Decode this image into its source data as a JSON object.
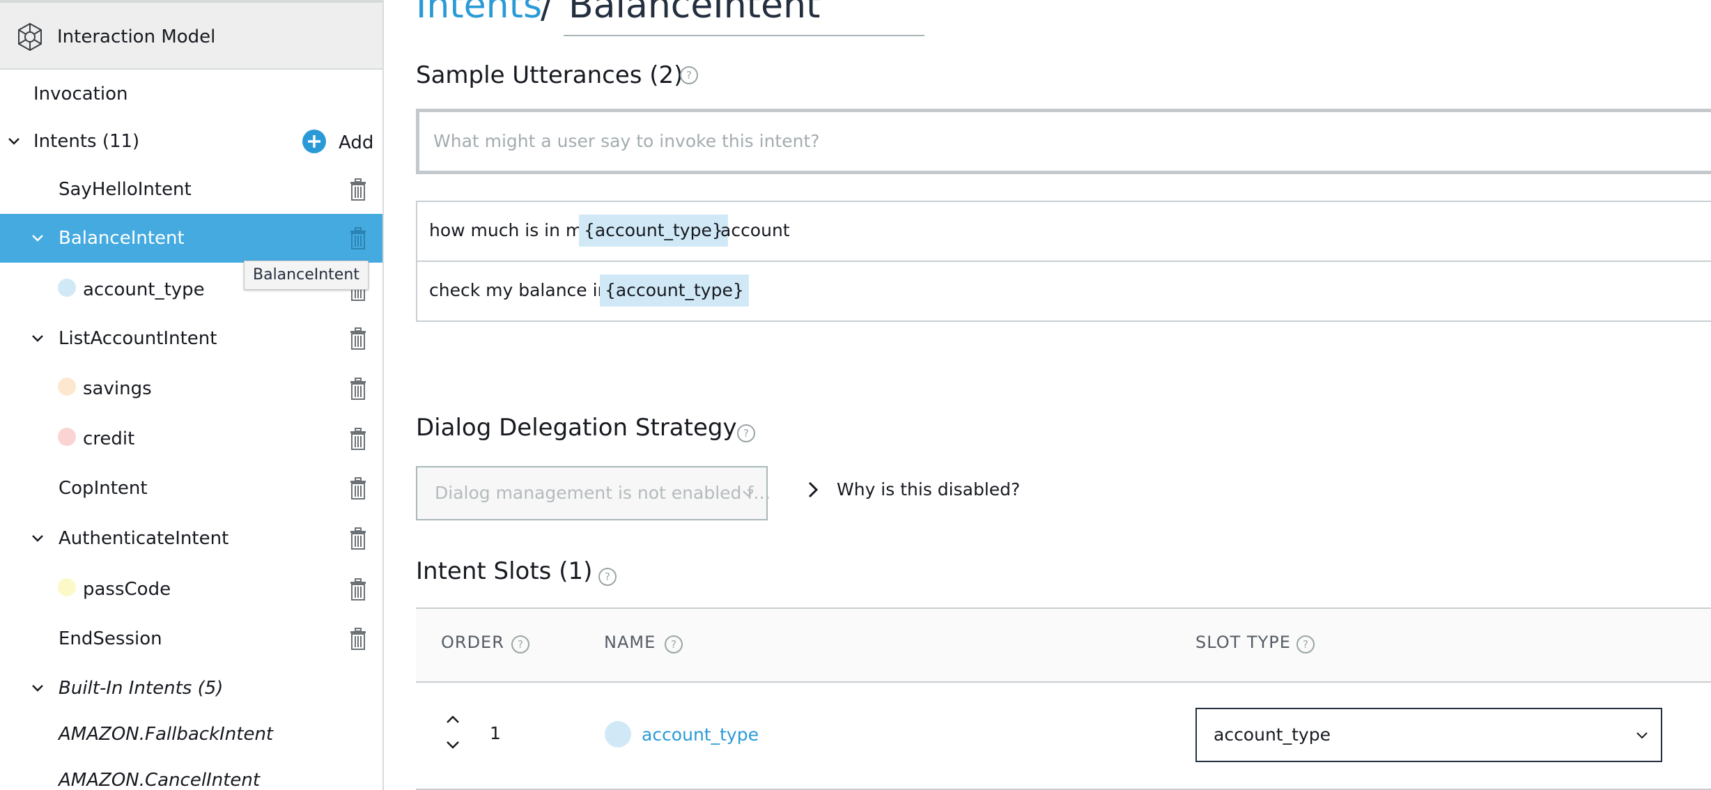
{
  "sidebar": {
    "header": {
      "title": "Interaction Model",
      "icon": "gear-icon"
    },
    "invocation": "Invocation",
    "intents_label": "Intents (11)",
    "add_label": "Add",
    "items": [
      {
        "label": "SayHelloIntent"
      },
      {
        "label": "BalanceIntent",
        "selected": true
      },
      {
        "label": "account_type",
        "dot_color": "#d1e9f7"
      },
      {
        "label": "ListAccountIntent"
      },
      {
        "label": "savings",
        "dot_color": "#fde8cf"
      },
      {
        "label": "credit",
        "dot_color": "#fbd3d3"
      },
      {
        "label": "CopIntent"
      },
      {
        "label": "AuthenticateIntent"
      },
      {
        "label": "passCode",
        "dot_color": "#fcf9c9"
      },
      {
        "label": "EndSession"
      }
    ],
    "builtin_label": "Built-In Intents (5)",
    "builtin_items": [
      {
        "label": "AMAZON.FallbackIntent"
      },
      {
        "label": "AMAZON.CancelIntent"
      }
    ],
    "tooltip": "BalanceIntent"
  },
  "breadcrumb": {
    "parent": "Intents",
    "separator": "/",
    "current": "BalanceIntent"
  },
  "utterances": {
    "title": "Sample Utterances (2)",
    "help": "?",
    "placeholder": "What might a user say to invoke this intent?",
    "rows": [
      {
        "before": "how much is in my",
        "slot": "{account_type}",
        "after": "account"
      },
      {
        "before": "check my  balance in",
        "slot": "{account_type}",
        "after": ""
      }
    ]
  },
  "dialog": {
    "title": "Dialog Delegation Strategy",
    "help": "?",
    "select_value": "Dialog management is not enabled f…",
    "why_label": "Why is this disabled?"
  },
  "slots": {
    "title": "Intent Slots (1)",
    "help": "?",
    "columns": {
      "order": "ORDER",
      "name": "NAME",
      "slot_type": "SLOT TYPE"
    },
    "rows": [
      {
        "order": "1",
        "name": "account_type",
        "slot_type": "account_type"
      }
    ]
  },
  "colors": {
    "accent": "#44aadf",
    "link": "#2a9ad6",
    "slot_highlight": "#d1e9f7"
  }
}
